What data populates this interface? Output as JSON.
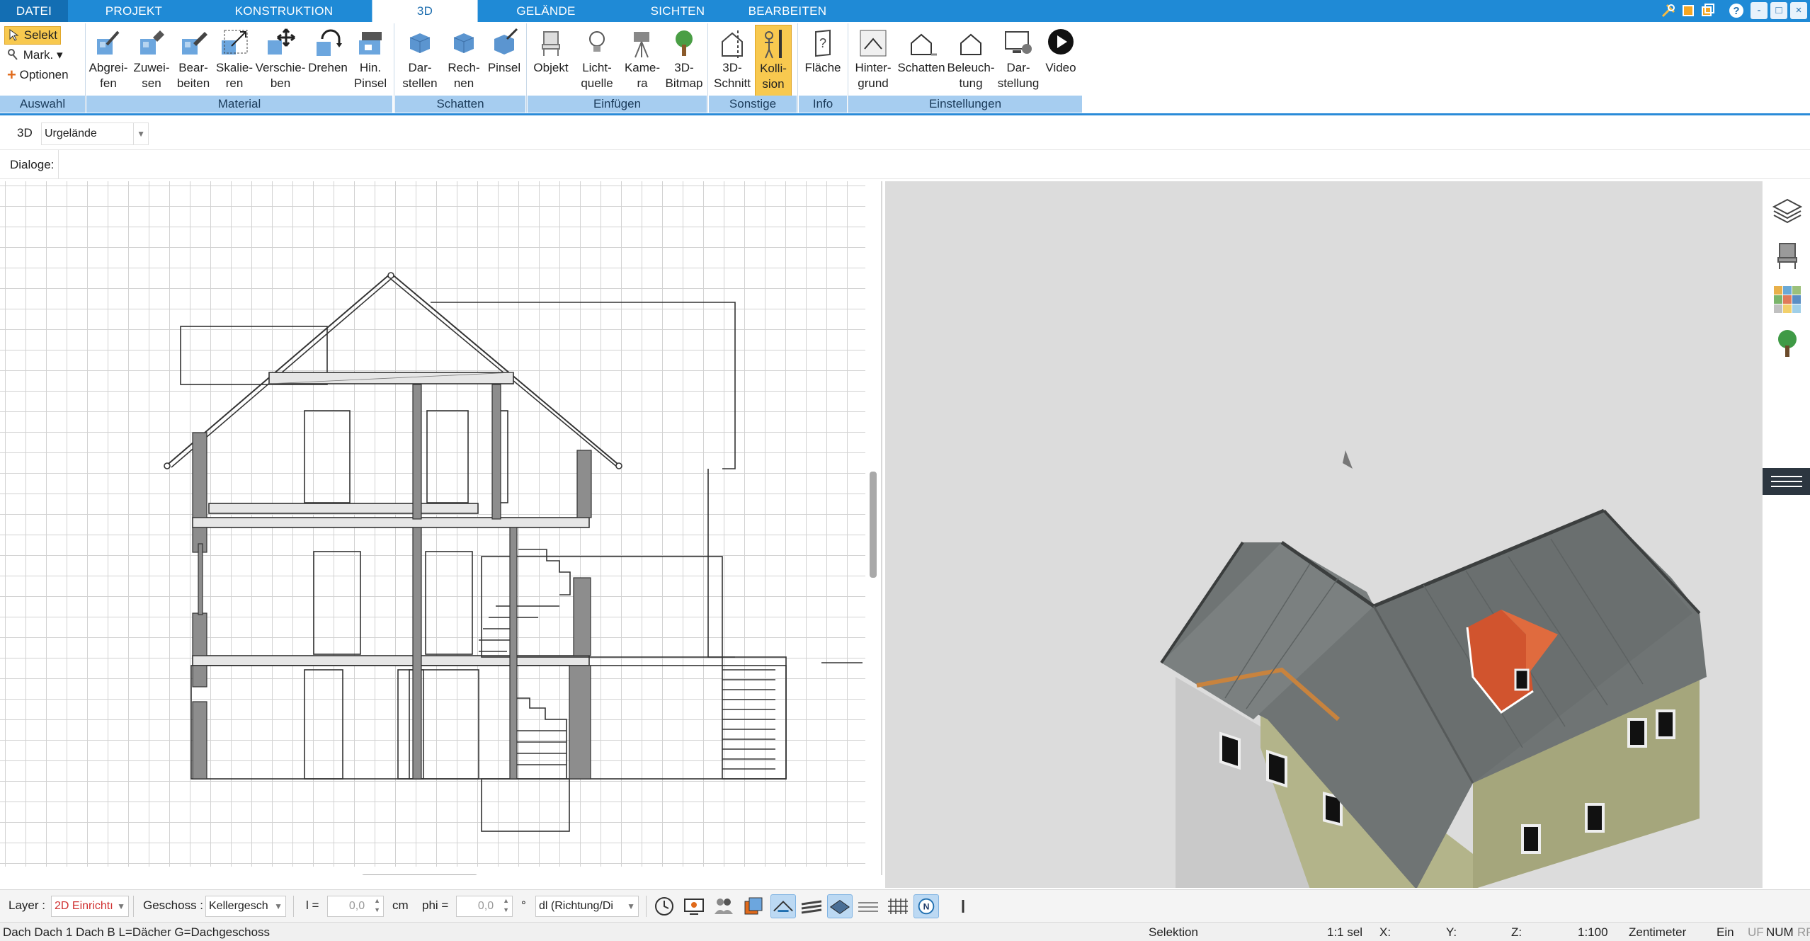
{
  "tabs": [
    {
      "label": "DATEI",
      "state": "file"
    },
    {
      "label": "PROJEKT"
    },
    {
      "label": "KONSTRUKTION"
    },
    {
      "label": "3D",
      "state": "active"
    },
    {
      "label": "GELÄNDE"
    },
    {
      "label": "SICHTEN"
    },
    {
      "label": "BEARBEITEN"
    }
  ],
  "window_controls": {
    "tools_icon": "tools-icon",
    "restore_icon": "restore-icon",
    "copy_icon": "copy-icon",
    "help": "?",
    "minimize": "-",
    "maximize": "□",
    "close": "×"
  },
  "ribbon": {
    "selection": {
      "select": "Selekt",
      "mark": "Mark.",
      "options": "Optionen",
      "group": "Auswahl"
    },
    "material": {
      "group": "Material",
      "buttons": [
        "Abgrei-\nfen",
        "Zuwei-\nsen",
        "Bear-\nbeiten",
        "Skalie-\nren",
        "Verschie-\nben",
        "Drehen",
        "Hin.\nPinsel"
      ]
    },
    "schatten": {
      "group": "Schatten",
      "buttons": [
        "Dar-\nstellen",
        "Rech-\nnen",
        "Pinsel"
      ]
    },
    "einfuegen": {
      "group": "Einfügen",
      "buttons": [
        "Objekt",
        "Licht-\nquelle",
        "Kame-\nra",
        "3D-\nBitmap"
      ]
    },
    "sonstige": {
      "group": "Sonstige",
      "buttons": [
        "3D-\nSchnitt",
        "Kolli-\nsion"
      ]
    },
    "info": {
      "group": "Info",
      "buttons": [
        "Fläche"
      ]
    },
    "einstellungen": {
      "group": "Einstellungen",
      "buttons": [
        "Hinter-\ngrund",
        "Schatten",
        "Beleuch-\ntung",
        "Dar-\nstellung",
        "Video"
      ]
    }
  },
  "viewbar": {
    "mode": "3D",
    "terrain": "Urgelände"
  },
  "dialogbar": {
    "label": "Dialoge:"
  },
  "sidepanel": {
    "icons": [
      "layers-icon",
      "chair-icon",
      "color-palette-icon",
      "tree-icon",
      "menu-icon"
    ]
  },
  "bottombar": {
    "layer_label": "Layer :",
    "layer_value": "2D Einrichtı",
    "floor_label": "Geschoss :",
    "floor_value": "Kellergesch",
    "l_label": "l =",
    "l_value": "0,0",
    "l_unit": "cm",
    "phi_label": "phi =",
    "phi_value": "0,0",
    "phi_unit": "°",
    "direction_value": "dl (Richtung/Di",
    "icons": [
      "clock-icon",
      "monitor-icon",
      "people-icon",
      "copy-layer-icon",
      "roof-edit-icon",
      "roof-layers-icon",
      "floor-icon",
      "stack-icon",
      "grid-icon",
      "north-icon",
      "more-icon"
    ],
    "north_letter": "N"
  },
  "statusbar": {
    "message": "Dach Dach 1 Dach B L=Dächer G=Dachgeschoss",
    "mode": "Selektion",
    "scale_sel": "1:1 sel",
    "x_label": "X:",
    "y_label": "Y:",
    "z_label": "Z:",
    "scale": "1:100",
    "unit": "Zentimeter",
    "ein": "Ein",
    "uf": "UF",
    "num": "NUM",
    "rf": "RF"
  },
  "colors": {
    "accent": "#1f8ad6",
    "group_label": "#a6cdf0",
    "active_button": "#f8c94f",
    "roof": "#6f7474",
    "dormer": "#d1542e",
    "wall": "#a5a67c"
  }
}
